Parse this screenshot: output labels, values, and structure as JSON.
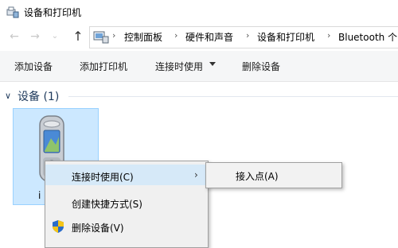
{
  "window": {
    "title": "设备和打印机"
  },
  "address": {
    "breadcrumbs": [
      "控制面板",
      "硬件和声音",
      "设备和打印机",
      "Bluetooth 个"
    ]
  },
  "toolbar": {
    "add_device": "添加设备",
    "add_printer": "添加打印机",
    "connect_using": "连接时使用",
    "remove_device": "删除设备"
  },
  "section": {
    "title": "设备 (1)"
  },
  "device": {
    "label": "i"
  },
  "context_menu": {
    "items": [
      {
        "label": "连接时使用(C)"
      },
      {
        "label": "创建快捷方式(S)"
      },
      {
        "label": "删除设备(V)"
      }
    ]
  },
  "submenu": {
    "items": [
      {
        "label": "接入点(A)"
      }
    ]
  },
  "icons": {
    "title": "devices-printers-icon",
    "address": "control-panel-icon",
    "device": "mobile-phone-icon",
    "remove": "shield-icon"
  },
  "colors": {
    "selection": "#cce8ff",
    "menu_highlight": "#d6e9f8",
    "section_title": "#1e395b"
  }
}
